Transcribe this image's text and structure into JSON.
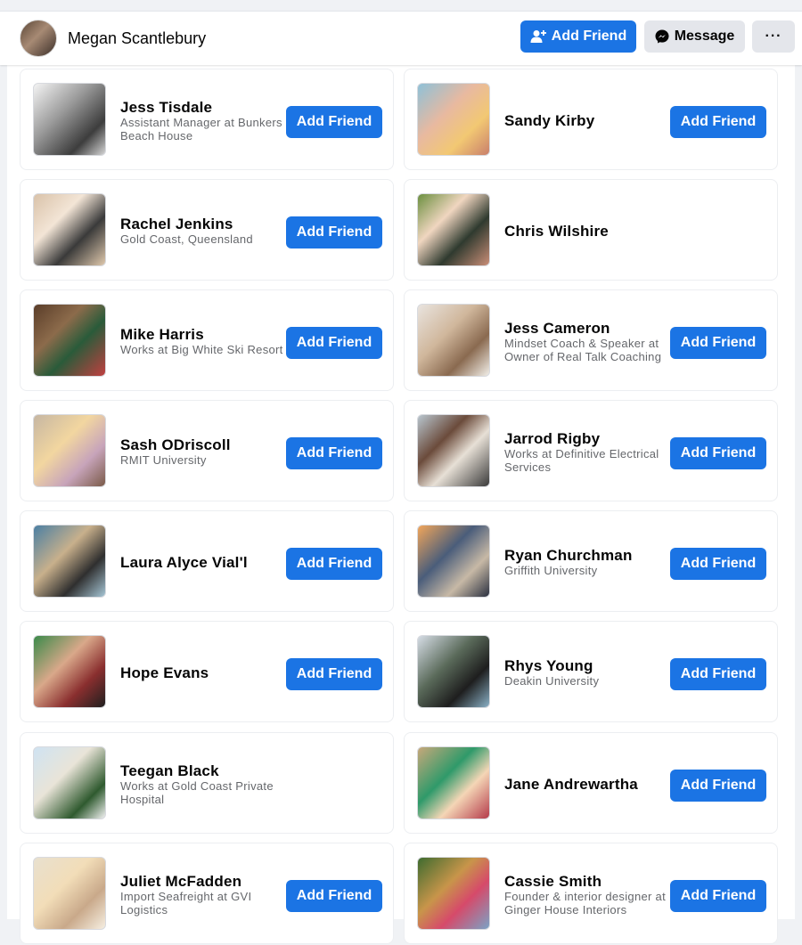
{
  "header": {
    "profile_name": "Megan Scantlebury",
    "add_friend_label": "Add Friend",
    "message_label": "Message",
    "more_label": "···",
    "accent": "#1b74e4"
  },
  "friends": [
    {
      "name": "Jess Tisdale",
      "desc": "Assistant Manager at Bunkers Beach House",
      "button": "Add Friend"
    },
    {
      "name": "Sandy Kirby",
      "desc": "",
      "button": "Add Friend"
    },
    {
      "name": "Rachel Jenkins",
      "desc": "Gold Coast, Queensland",
      "button": "Add Friend"
    },
    {
      "name": "Chris Wilshire",
      "desc": "",
      "button": ""
    },
    {
      "name": "Mike Harris",
      "desc": "Works at Big White Ski Resort",
      "button": "Add Friend"
    },
    {
      "name": "Jess Cameron",
      "desc": "Mindset Coach & Speaker at Owner of Real Talk Coaching",
      "button": "Add Friend"
    },
    {
      "name": "Sash ODriscoll",
      "desc": "RMIT University",
      "button": "Add Friend"
    },
    {
      "name": "Jarrod Rigby",
      "desc": "Works at Definitive Electrical Services",
      "button": "Add Friend"
    },
    {
      "name": "Laura Alyce Vial'l",
      "desc": "",
      "button": "Add Friend"
    },
    {
      "name": "Ryan Churchman",
      "desc": "Griffith University",
      "button": "Add Friend"
    },
    {
      "name": "Hope Evans",
      "desc": "",
      "button": "Add Friend"
    },
    {
      "name": "Rhys Young",
      "desc": "Deakin University",
      "button": "Add Friend"
    },
    {
      "name": "Teegan Black",
      "desc": "Works at Gold Coast Private Hospital",
      "button": ""
    },
    {
      "name": "Jane Andrewartha",
      "desc": "",
      "button": "Add Friend"
    },
    {
      "name": "Juliet McFadden",
      "desc": "Import Seafreight at GVI Logistics",
      "button": "Add Friend"
    },
    {
      "name": "Cassie Smith",
      "desc": "Founder & interior designer at Ginger House Interiors",
      "button": "Add Friend"
    }
  ]
}
